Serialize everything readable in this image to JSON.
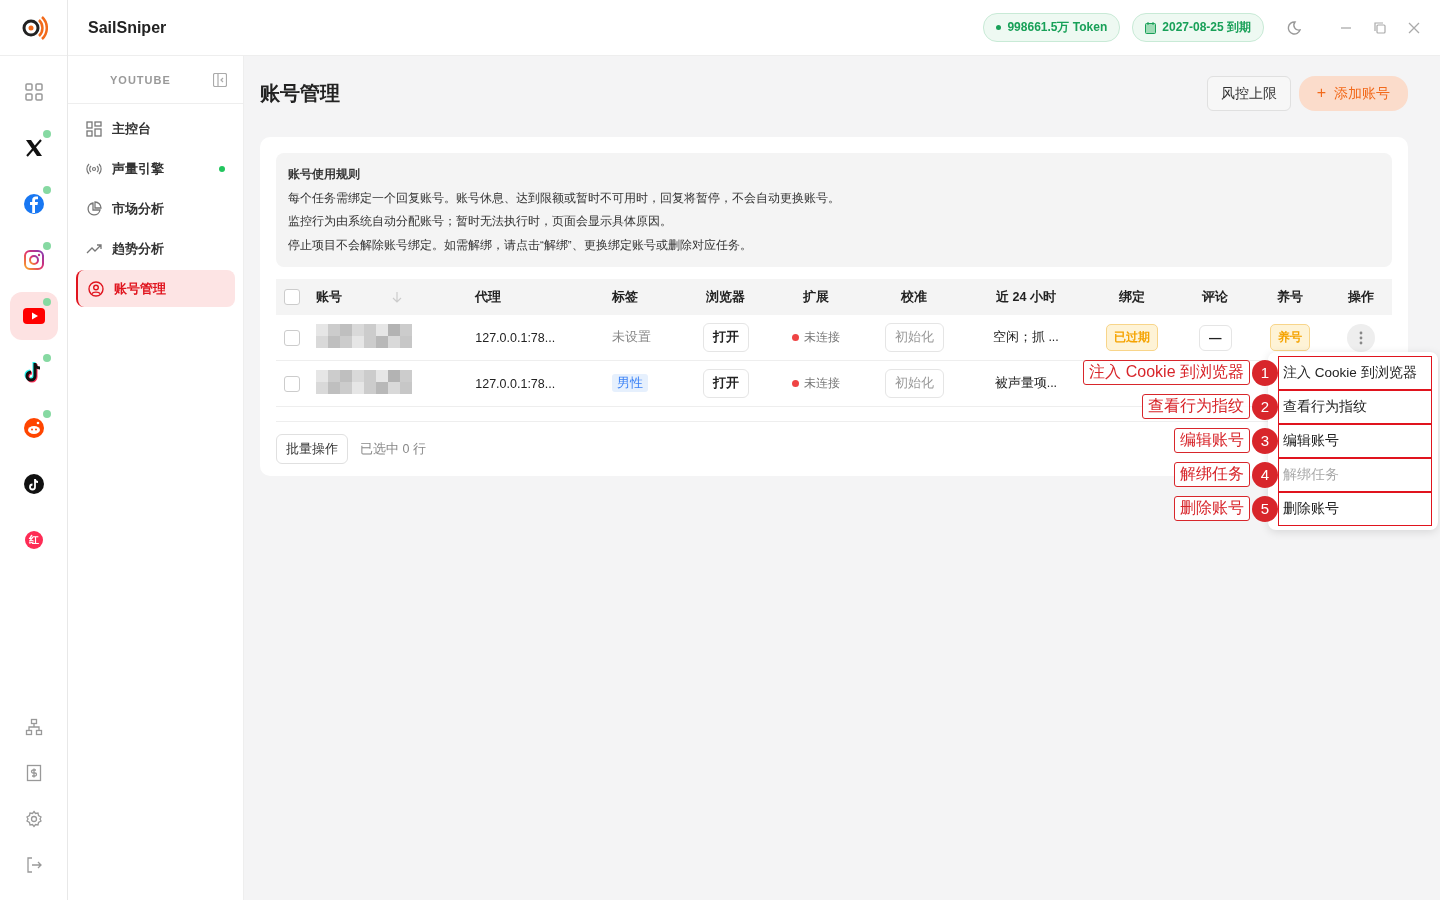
{
  "app": {
    "name": "SailSniper"
  },
  "topbar": {
    "token": "998661.5万 Token",
    "expiry": "2027-08-25 到期"
  },
  "platforms": [
    {
      "kind": "grid",
      "selected": false,
      "online": false
    },
    {
      "kind": "x",
      "selected": false,
      "online": true
    },
    {
      "kind": "facebook",
      "selected": false,
      "online": true
    },
    {
      "kind": "instagram",
      "selected": false,
      "online": true
    },
    {
      "kind": "youtube",
      "selected": true,
      "online": true
    },
    {
      "kind": "tiktok",
      "selected": false,
      "online": true
    },
    {
      "kind": "reddit",
      "selected": false,
      "online": true
    },
    {
      "kind": "tiktok-dark",
      "selected": false,
      "online": false
    },
    {
      "kind": "red",
      "selected": false,
      "online": false,
      "glyph": "红"
    }
  ],
  "sidebar": {
    "platform": "YOUTUBE",
    "items": [
      {
        "label": "主控台",
        "selected": false,
        "online": false
      },
      {
        "label": "声量引擎",
        "selected": false,
        "online": true
      },
      {
        "label": "市场分析",
        "selected": false,
        "online": false
      },
      {
        "label": "趋势分析",
        "selected": false,
        "online": false
      },
      {
        "label": "账号管理",
        "selected": true,
        "online": false
      }
    ]
  },
  "page": {
    "title": "账号管理",
    "buttons": [
      "风控上限",
      "添加账号"
    ],
    "add_icon": "+"
  },
  "rules": {
    "title": "账号使用规则",
    "lines": [
      "每个任务需绑定一个回复账号。账号休息、达到限额或暂时不可用时，回复将暂停，不会自动更换账号。",
      "监控行为由系统自动分配账号；暂时无法执行时，页面会显示具体原因。",
      "停止项目不会解除账号绑定。如需解绑，请点击“解绑”、更换绑定账号或删除对应任务。"
    ]
  },
  "table": {
    "columns": [
      "账号",
      "代理",
      "标签",
      "浏览器",
      "扩展",
      "校准",
      "近 24 小时",
      "绑定",
      "评论",
      "养号",
      "操作"
    ],
    "rows": [
      {
        "checked": false,
        "proxy": "127.0.0.1:78...",
        "tag": "未设置",
        "tag_set": false,
        "browser": "打开",
        "extension": "未连接",
        "calibrate": "初始化",
        "last24": "空闲；抓 ...",
        "bind": "已过期",
        "comment": "—",
        "nurture": "养号"
      },
      {
        "checked": false,
        "proxy": "127.0.0.1:78...",
        "tag": "男性",
        "tag_set": true,
        "browser": "打开",
        "extension": "未连接",
        "calibrate": "初始化",
        "last24": "被声量项..."
      }
    ],
    "all_checked": false,
    "batch": "批量操作",
    "selected_count": "已选中 0 行"
  },
  "menu": [
    {
      "label": "注入 Cookie 到浏览器",
      "disabled": false
    },
    {
      "label": "查看行为指纹",
      "disabled": false
    },
    {
      "label": "编辑账号",
      "disabled": false
    },
    {
      "label": "解绑任务",
      "disabled": true
    },
    {
      "label": "删除账号",
      "disabled": false
    }
  ],
  "annotations": [
    {
      "number": "1",
      "label": "注入 Cookie 到浏览器"
    },
    {
      "number": "2",
      "label": "查看行为指纹"
    },
    {
      "number": "3",
      "label": "编辑账号"
    },
    {
      "number": "4",
      "label": "解绑任务"
    },
    {
      "number": "5",
      "label": "删除账号"
    }
  ]
}
